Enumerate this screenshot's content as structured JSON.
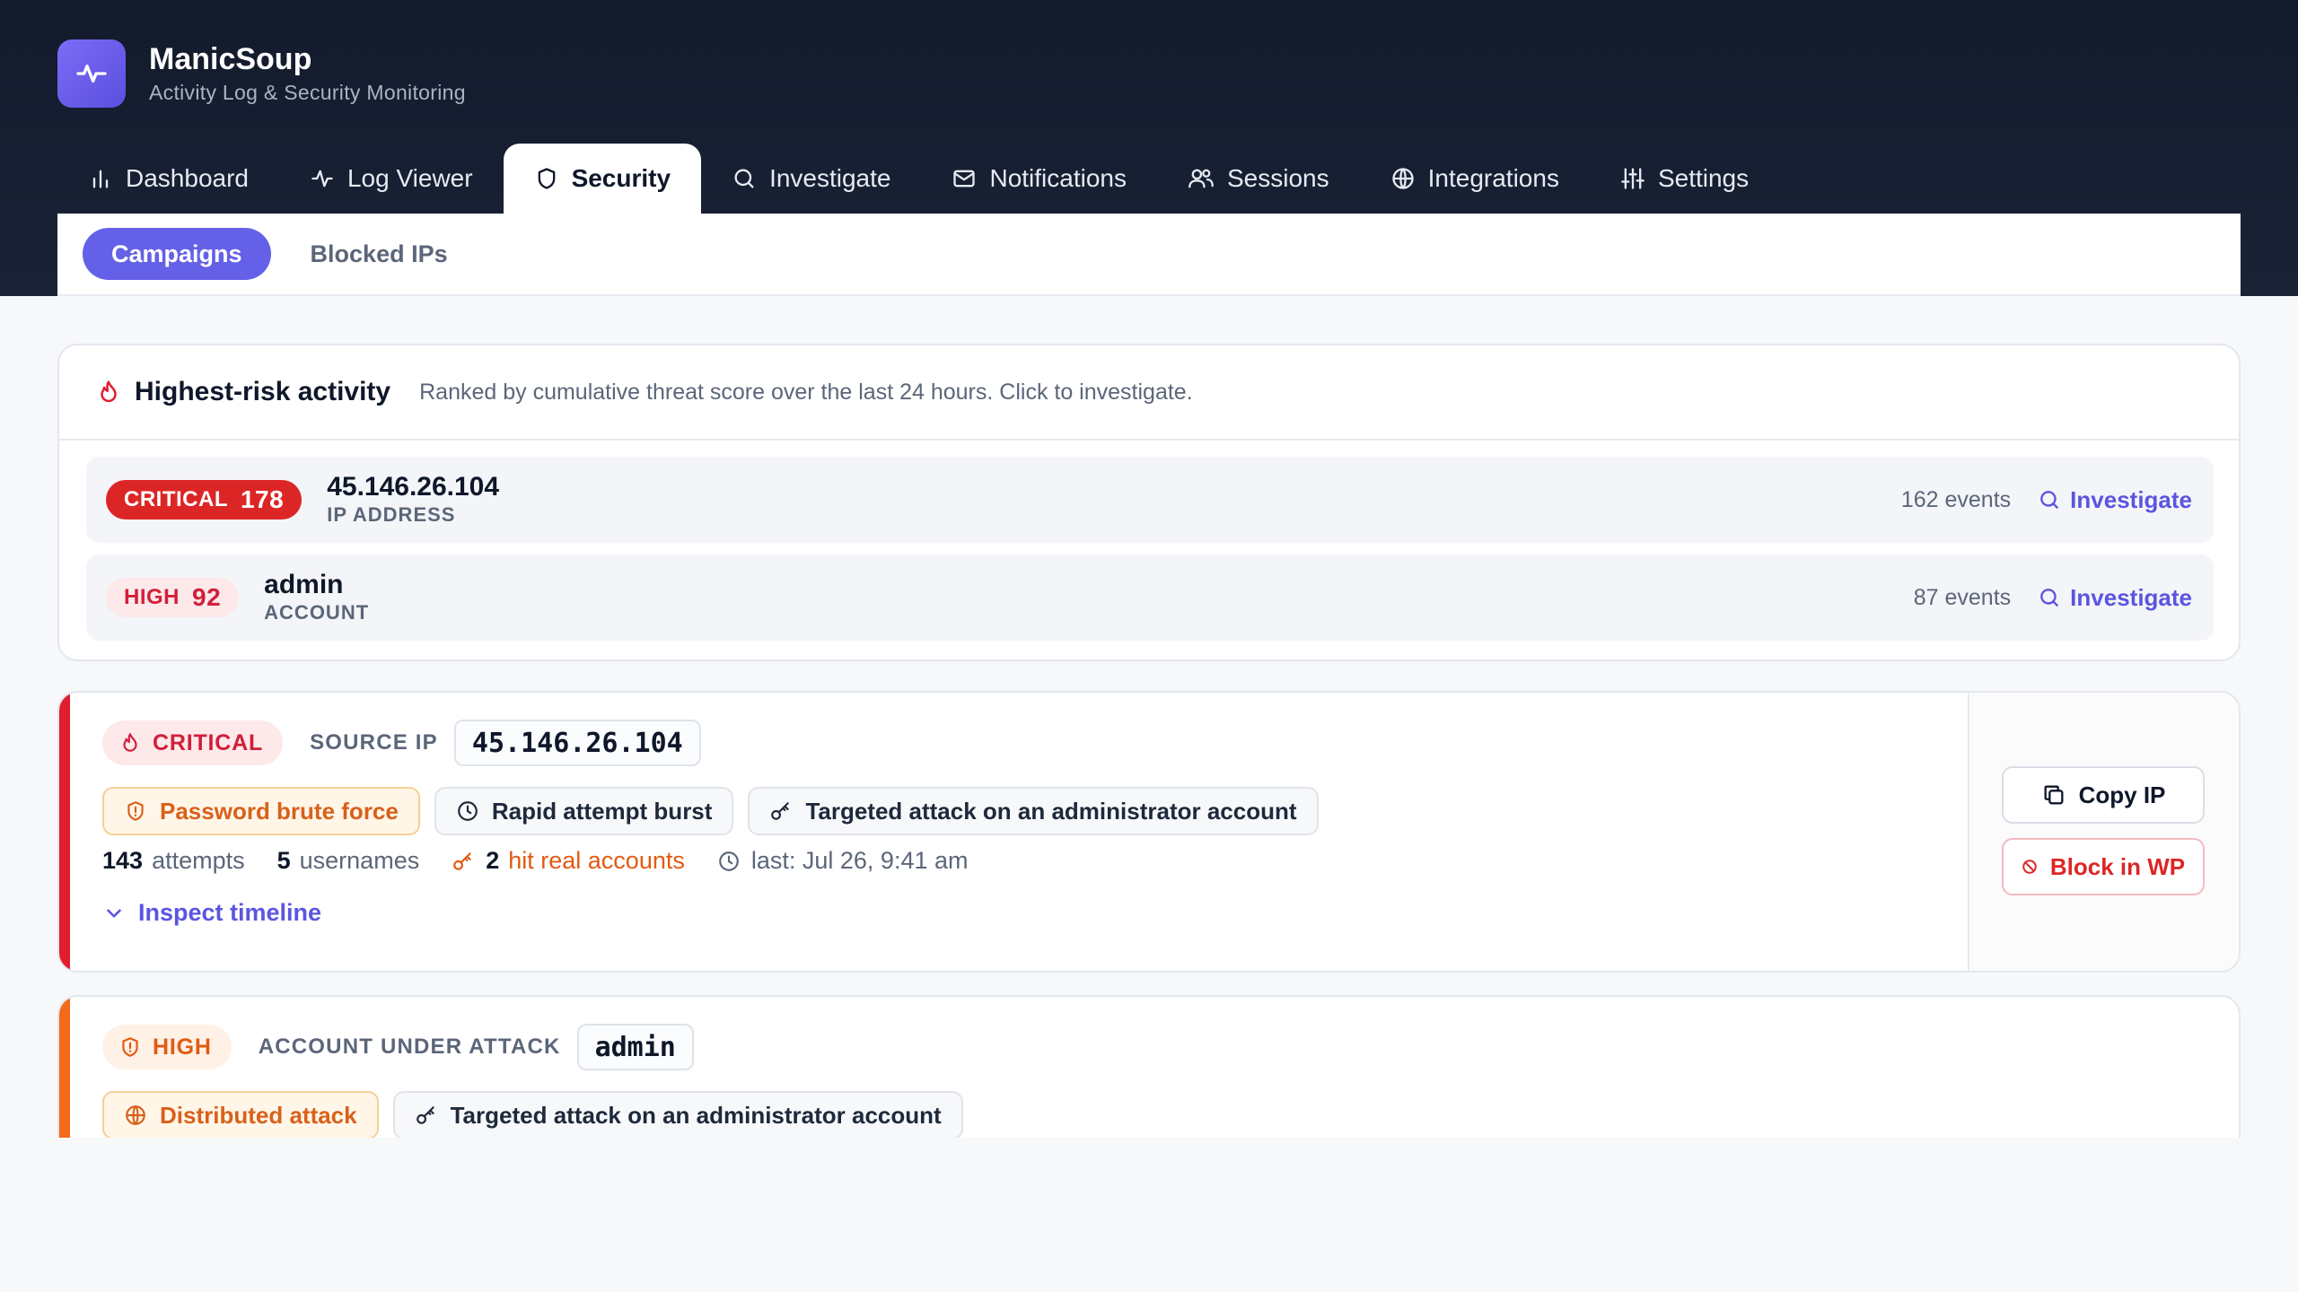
{
  "app": {
    "name": "ManicSoup",
    "subtitle": "Activity Log & Security Monitoring",
    "accent": "#6460e8"
  },
  "nav": {
    "tabs": [
      {
        "label": "Dashboard",
        "icon": "bar-chart-icon"
      },
      {
        "label": "Log Viewer",
        "icon": "activity-icon"
      },
      {
        "label": "Security",
        "icon": "shield-icon",
        "active": true
      },
      {
        "label": "Investigate",
        "icon": "search-icon"
      },
      {
        "label": "Notifications",
        "icon": "mail-icon"
      },
      {
        "label": "Sessions",
        "icon": "users-icon"
      },
      {
        "label": "Integrations",
        "icon": "globe-icon"
      },
      {
        "label": "Settings",
        "icon": "sliders-icon"
      }
    ]
  },
  "subnav": {
    "items": [
      {
        "label": "Campaigns",
        "active": true
      },
      {
        "label": "Blocked IPs",
        "active": false
      }
    ]
  },
  "risk": {
    "title": "Highest-risk activity",
    "subtitle": "Ranked by cumulative threat score over the last 24 hours. Click to investigate.",
    "rows": [
      {
        "severity": "CRITICAL",
        "score": "178",
        "value": "45.146.26.104",
        "kind": "IP ADDRESS",
        "events": "162 events",
        "action": "Investigate",
        "color": "#dc2626"
      },
      {
        "severity": "HIGH",
        "score": "92",
        "value": "admin",
        "kind": "ACCOUNT",
        "events": "87 events",
        "action": "Investigate",
        "color": "#d11f3a"
      }
    ]
  },
  "campaigns": [
    {
      "severity": "CRITICAL",
      "target_label": "SOURCE IP",
      "target_value": "45.146.26.104",
      "tags": [
        {
          "label": "Password brute force",
          "icon": "shield-alert-icon",
          "style": "warn"
        },
        {
          "label": "Rapid attempt burst",
          "icon": "clock-icon",
          "style": "neutral"
        },
        {
          "label": "Targeted attack on an administrator account",
          "icon": "key-icon",
          "style": "neutral"
        }
      ],
      "stats": {
        "attempts_count": "143",
        "attempts_label": "attempts",
        "usernames_count": "5",
        "usernames_label": "usernames",
        "hits_count": "2",
        "hits_label": "hit real accounts",
        "last": "last: Jul 26, 9:41 am"
      },
      "inspect_label": "Inspect timeline",
      "actions": {
        "copy": "Copy IP",
        "block": "Block in WP"
      }
    },
    {
      "severity": "HIGH",
      "target_label": "ACCOUNT UNDER ATTACK",
      "target_value": "admin",
      "tags": [
        {
          "label": "Distributed attack",
          "icon": "globe-icon",
          "style": "warn"
        },
        {
          "label": "Targeted attack on an administrator account",
          "icon": "key-icon",
          "style": "neutral"
        }
      ]
    }
  ]
}
